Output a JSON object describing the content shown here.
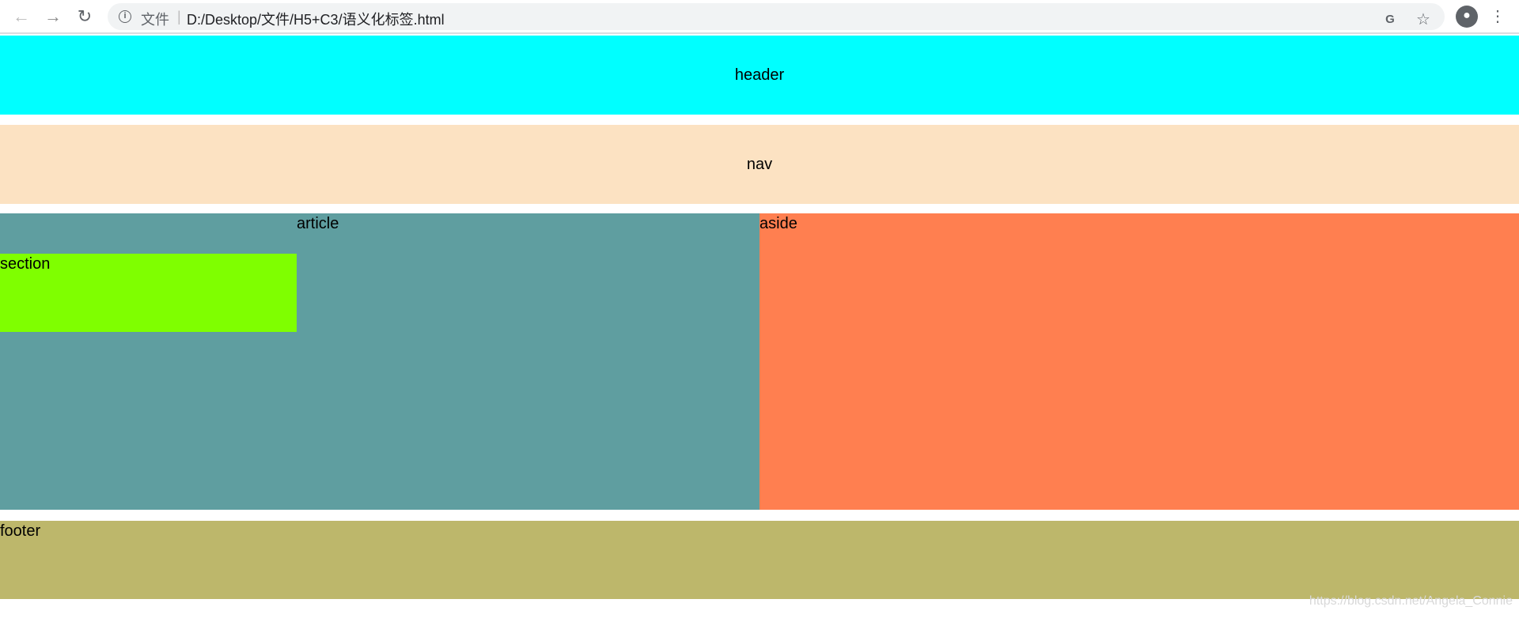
{
  "browser": {
    "scheme_label": "文件",
    "url": "D:/Desktop/文件/H5+C3/语义化标签.html"
  },
  "page": {
    "header": "header",
    "nav": "nav",
    "article": "article",
    "section": "section",
    "aside": "aside",
    "footer": "footer"
  },
  "colors": {
    "header": "#00ffff",
    "nav": "#fce2c2",
    "article": "#5f9ea0",
    "section": "#7fff00",
    "aside": "#ff7f50",
    "footer": "#bdb76b"
  },
  "watermark": "https://blog.csdn.net/Angela_Connie"
}
